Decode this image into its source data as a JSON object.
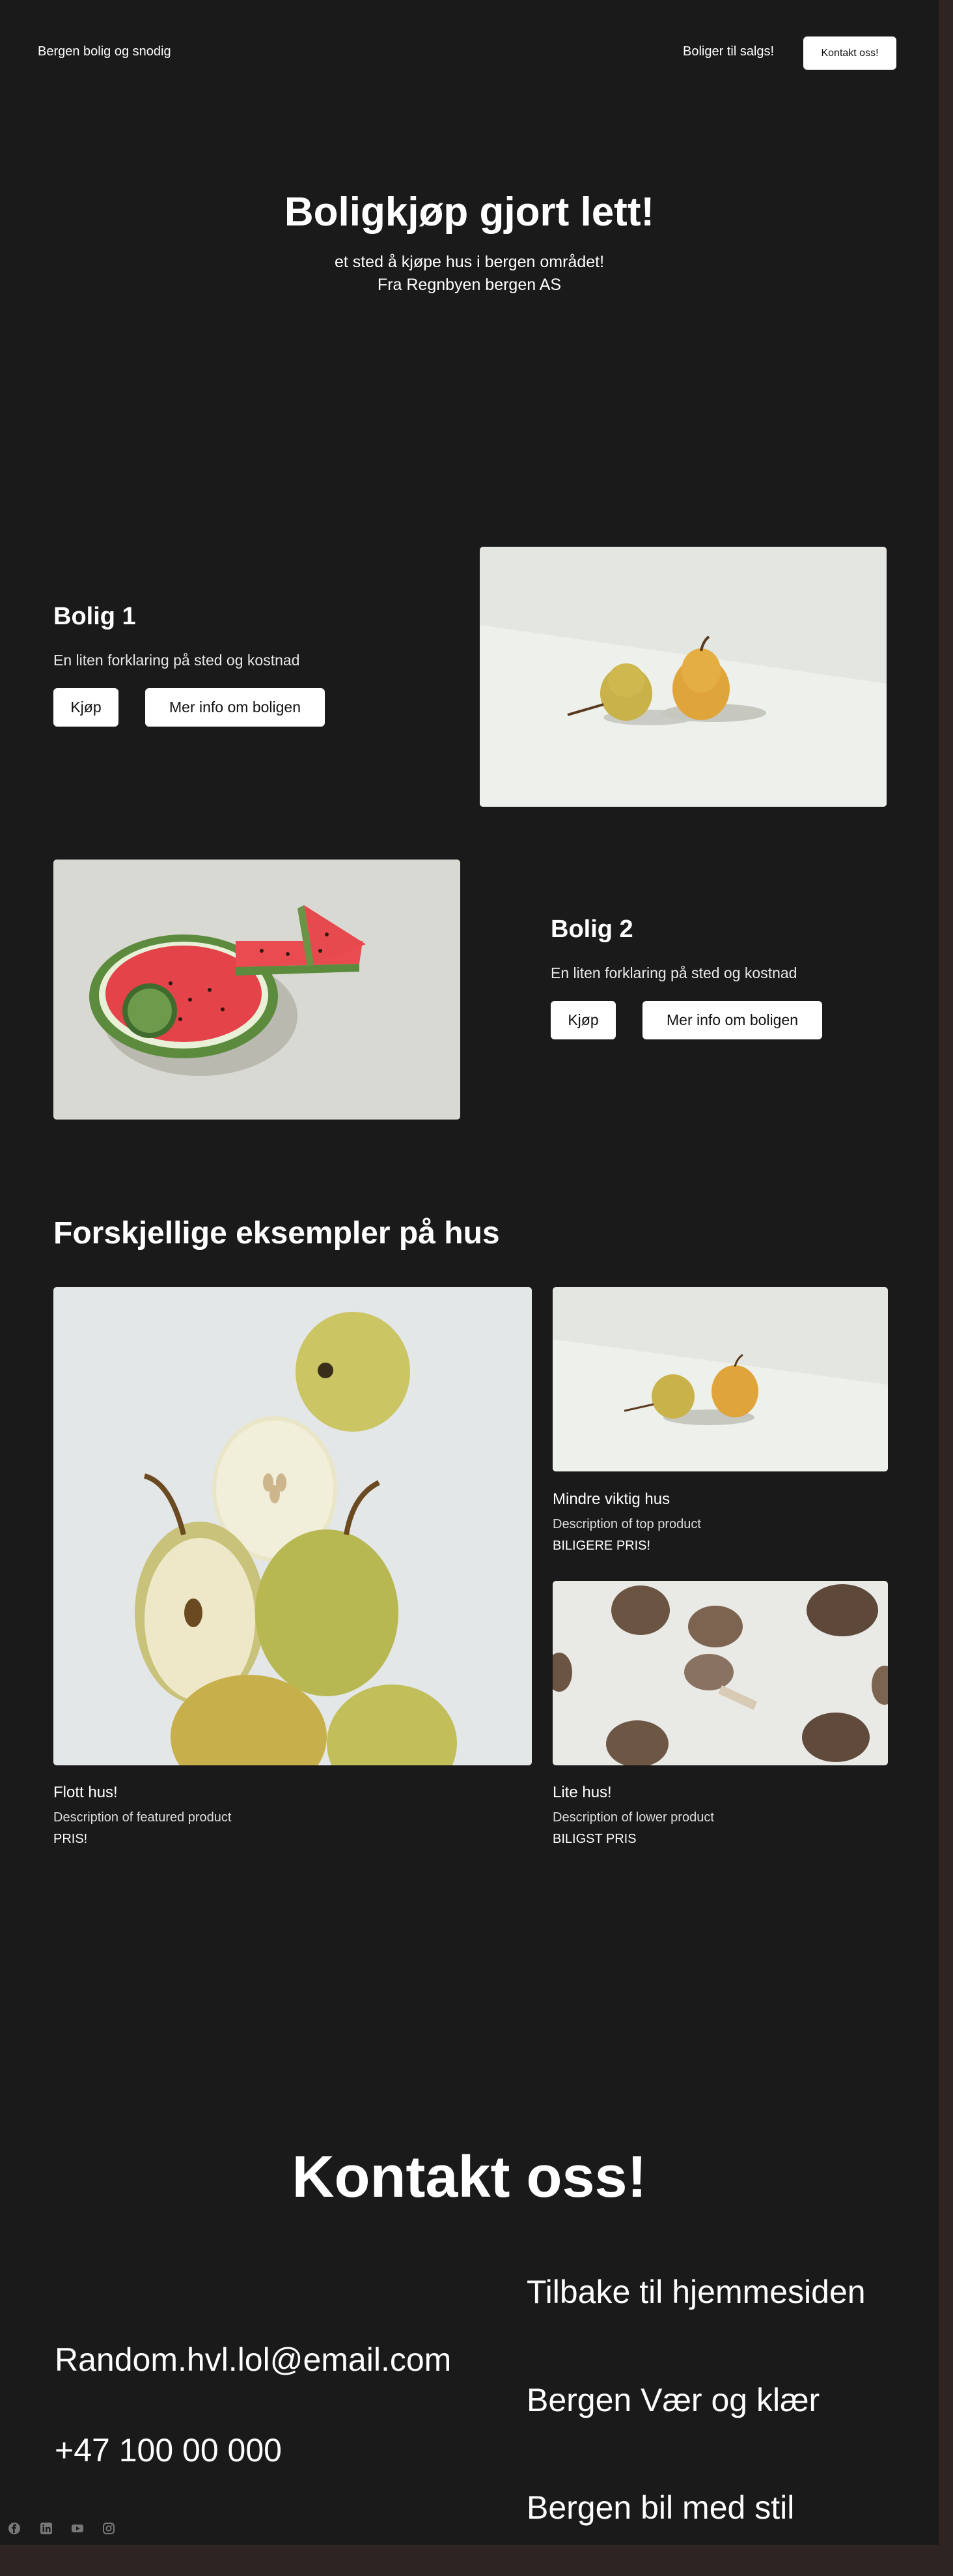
{
  "nav": {
    "brand": "Bergen bolig og snodig",
    "link": "Boliger til salgs!",
    "button": "Kontakt oss!"
  },
  "hero": {
    "title": "Boligkjøp gjort lett!",
    "subtitle_1": "et sted å kjøpe hus i bergen området!",
    "subtitle_2": "Fra Regnbyen bergen AS"
  },
  "features": [
    {
      "title": "Bolig 1",
      "description": "En liten forklaring på sted og kostnad",
      "buy": "Kjøp",
      "more": "Mer info om boligen",
      "image": "pears-image"
    },
    {
      "title": "Bolig 2",
      "description": "En liten forklaring på sted og kostnad",
      "buy": "Kjøp",
      "more": "Mer info om boligen",
      "image": "watermelon-image"
    }
  ],
  "examples": {
    "title": "Forskjellige eksempler på hus",
    "items": [
      {
        "title": "Flott hus!",
        "description": "Description of featured product",
        "price": "PRIS!",
        "image": "pear-stack-image"
      },
      {
        "title": "Mindre viktig hus",
        "description": "Description of top product",
        "price": "BILIGERE PRIS!",
        "image": "pears-image"
      },
      {
        "title": "Lite hus!",
        "description": "Description of lower product",
        "price": "BILIGST PRIS",
        "image": "mushrooms-image"
      }
    ]
  },
  "contact": {
    "title": "Kontakt oss!",
    "email": "Random.hvl.lol@email.com",
    "phone": "+47 100 00 000",
    "links": [
      "Tilbake til hjemmesiden",
      "Bergen Vær og klær",
      "Bergen bil med stil"
    ]
  },
  "social": [
    "facebook-icon",
    "linkedin-icon",
    "youtube-icon",
    "instagram-icon"
  ],
  "colors": {
    "background": "#1a1a1a",
    "outer": "#2e2523",
    "button_bg": "#ffffff",
    "text": "#ffffff"
  }
}
